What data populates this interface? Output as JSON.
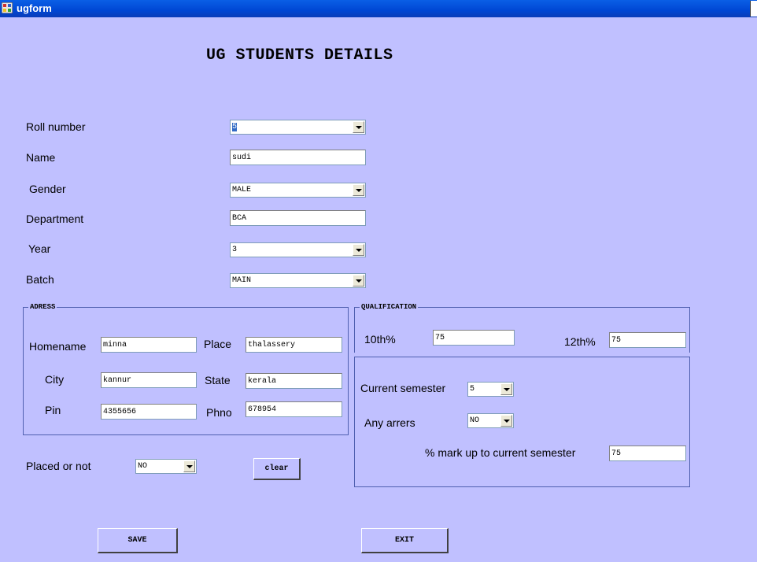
{
  "window": {
    "title": "ugform",
    "app_icon": "form-icon"
  },
  "heading": "UG STUDENTS DETAILS",
  "fields": {
    "roll_number": {
      "label": "Roll number",
      "value": "5"
    },
    "name": {
      "label": "Name",
      "value": "sudi"
    },
    "gender": {
      "label": "Gender",
      "value": "MALE"
    },
    "department": {
      "label": "Department",
      "value": "BCA"
    },
    "year": {
      "label": "Year",
      "value": "3"
    },
    "batch": {
      "label": "Batch",
      "value": "MAIN"
    }
  },
  "address": {
    "title": "ADRESS",
    "homename": {
      "label": "Homename",
      "value": "minna"
    },
    "place": {
      "label": "Place",
      "value": "thalassery"
    },
    "city": {
      "label": "City",
      "value": "kannur"
    },
    "state": {
      "label": "State",
      "value": "kerala"
    },
    "pin": {
      "label": "Pin",
      "value": "4355656"
    },
    "phno": {
      "label": "Phno",
      "value": "678954"
    }
  },
  "qualification": {
    "title": "QUALIFICATION",
    "tenth": {
      "label": "10th%",
      "value": "75"
    },
    "twelfth": {
      "label": "12th%",
      "value": "75"
    }
  },
  "semester": {
    "current": {
      "label": "Current semester",
      "value": "5"
    },
    "arrears": {
      "label": "Any arrers",
      "value": "NO"
    },
    "mark": {
      "label": "% mark up to current semester",
      "value": "75"
    }
  },
  "placed": {
    "label": "Placed or not",
    "value": "NO"
  },
  "buttons": {
    "clear": "clear",
    "save": "SAVE",
    "exit": "EXIT"
  },
  "colors": {
    "background": "#c0c0ff",
    "titlebar": "#0047d4",
    "border": "#5060b0"
  }
}
